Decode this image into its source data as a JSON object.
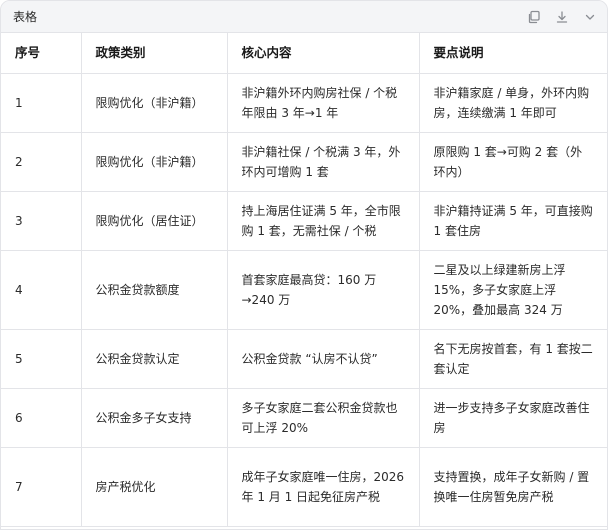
{
  "panel": {
    "title": "表格",
    "icons": [
      "copy-icon",
      "download-icon",
      "collapse-icon"
    ]
  },
  "table": {
    "headers": [
      "序号",
      "政策类别",
      "核心内容",
      "要点说明"
    ],
    "rows": [
      [
        "1",
        "限购优化（非沪籍）",
        "非沪籍外环内购房社保 / 个税年限由 3 年→1 年",
        "非沪籍家庭 / 单身，外环内购房，连续缴满 1 年即可"
      ],
      [
        "2",
        "限购优化（非沪籍）",
        "非沪籍社保 / 个税满 3 年，外环内可增购 1 套",
        "原限购 1 套→可购 2 套（外环内）"
      ],
      [
        "3",
        "限购优化（居住证）",
        "持上海居住证满 5 年，全市限购 1 套，无需社保 / 个税",
        "非沪籍持证满 5 年，可直接购 1 套住房"
      ],
      [
        "4",
        "公积金贷款额度",
        "首套家庭最高贷：160 万→240 万",
        "二星及以上绿建新房上浮 15%，多子女家庭上浮 20%，叠加最高 324 万"
      ],
      [
        "5",
        "公积金贷款认定",
        "公积金贷款 “认房不认贷”",
        "名下无房按首套，有 1 套按二套认定"
      ],
      [
        "6",
        "公积金多子女支持",
        "多子女家庭二套公积金贷款也可上浮 20%",
        "进一步支持多子女家庭改善住房"
      ],
      [
        "7",
        "房产税优化",
        "成年子女家庭唯一住房，2026 年 1 月 1 日起免征房产税",
        "支持置换，成年子女新购 / 置换唯一住房暂免房产税"
      ]
    ]
  }
}
